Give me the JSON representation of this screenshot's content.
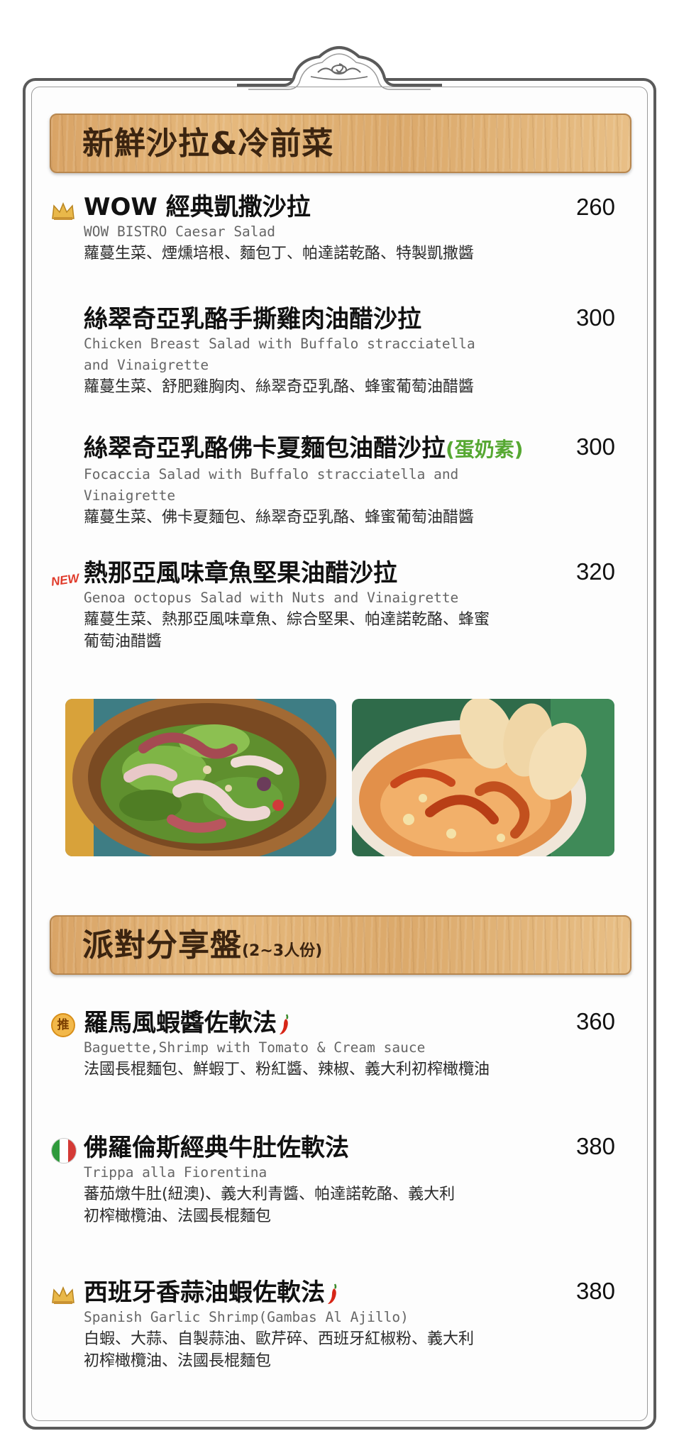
{
  "sections": [
    {
      "title": "新鮮沙拉&冷前菜",
      "subtitle": "",
      "items": [
        {
          "mark": "crown-icon",
          "name": "WOW 經典凱撒沙拉",
          "tag": "",
          "price": "260",
          "en": "WOW BISTRO Caesar Salad",
          "desc": "蘿蔓生菜、煙燻培根、麵包丁、帕達諾乾酪、特製凱撒醬"
        },
        {
          "mark": "",
          "name": "絲翠奇亞乳酪手撕雞肉油醋沙拉",
          "tag": "",
          "price": "300",
          "en": "Chicken Breast Salad with Buffalo stracciatella and Vinaigrette",
          "desc": "蘿蔓生菜、舒肥雞胸肉、絲翠奇亞乳酪、蜂蜜葡萄油醋醬"
        },
        {
          "mark": "",
          "name": "絲翠奇亞乳酪佛卡夏麵包油醋沙拉",
          "tag": "(蛋奶素)",
          "price": "300",
          "en": "Focaccia Salad with Buffalo stracciatella and Vinaigrette",
          "desc": "蘿蔓生菜、佛卡夏麵包、絲翠奇亞乳酪、蜂蜜葡萄油醋醬"
        },
        {
          "mark": "NEW",
          "name": "熱那亞風味章魚堅果油醋沙拉",
          "tag": "",
          "price": "320",
          "en": "Genoa octopus Salad with Nuts and Vinaigrette",
          "desc": "蘿蔓生菜、熱那亞風味章魚、綜合堅果、帕達諾乾酪、蜂蜜葡萄油醋醬"
        }
      ]
    },
    {
      "title": "派對分享盤",
      "subtitle": "(2~3人份)",
      "items": [
        {
          "mark": "推",
          "name": "羅馬風蝦醬佐軟法",
          "tag": "",
          "price": "360",
          "en": "Baguette,Shrimp with Tomato & Cream sauce",
          "desc": "法國長棍麵包、鮮蝦丁、粉紅醬、辣椒、義大利初榨橄欖油"
        },
        {
          "mark": "italy-flag-icon",
          "name": "佛羅倫斯經典牛肚佐軟法",
          "tag": "",
          "price": "380",
          "en": "Trippa alla Fiorentina",
          "desc": "蕃茄燉牛肚(紐澳)、義大利青醬、帕達諾乾酪、義大利初榨橄欖油、法國長棍麵包"
        },
        {
          "mark": "crown-icon",
          "name": "西班牙香蒜油蝦佐軟法",
          "tag": "",
          "price": "380",
          "en": "Spanish Garlic Shrimp(Gambas Al Ajillo)",
          "desc": "白蝦、大蒜、自製蒜油、歐芹碎、西班牙紅椒粉、義大利初榨橄欖油、法國長棍麵包"
        }
      ]
    }
  ],
  "photos": [
    {
      "icon": "octopus-salad-photo"
    },
    {
      "icon": "garlic-shrimp-photo"
    }
  ],
  "colors": {
    "frame": "#5a5a5a",
    "wood": "#dba96b",
    "banner_text": "#3b2410",
    "green_tag": "#56a832",
    "new_red": "#e03a2a",
    "chili_red": "#d72617"
  }
}
